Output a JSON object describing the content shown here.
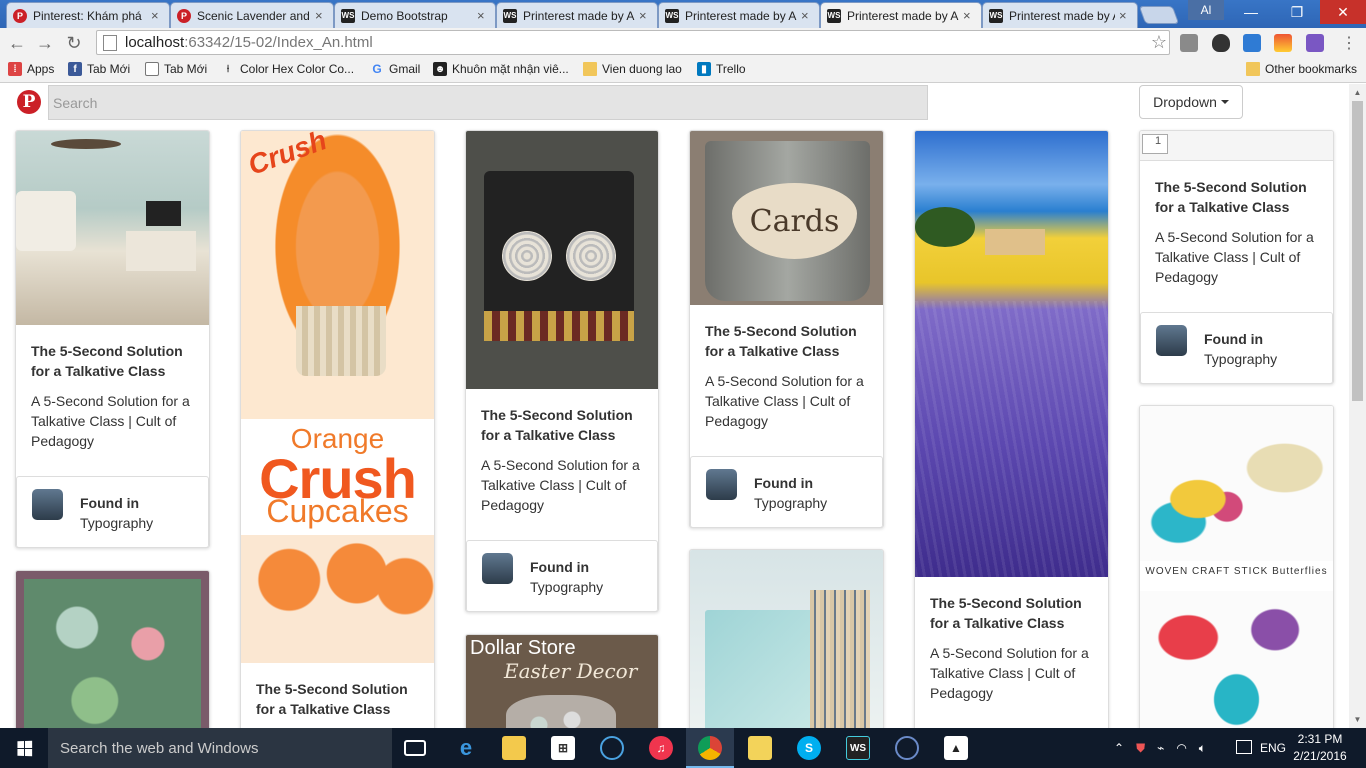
{
  "browser": {
    "tabs": [
      {
        "label": "Pinterest: Khám phá",
        "icon": "pinterest-icon",
        "active": false
      },
      {
        "label": "Scenic Lavender and",
        "icon": "pinterest-icon",
        "active": false
      },
      {
        "label": "Demo Bootstrap",
        "icon": "webstorm-icon",
        "active": false
      },
      {
        "label": "Printerest made by A",
        "icon": "webstorm-icon",
        "active": false
      },
      {
        "label": "Printerest made by A",
        "icon": "webstorm-icon",
        "active": false
      },
      {
        "label": "Printerest made by A",
        "icon": "webstorm-icon",
        "active": true
      },
      {
        "label": "Printerest made by A",
        "icon": "webstorm-icon",
        "active": false
      }
    ],
    "user_badge": "Al",
    "url_host": "localhost",
    "url_path": ":63342/15-02/Index_An.html",
    "bookmarks": [
      {
        "label": "Apps",
        "icon": "apps-grid-icon"
      },
      {
        "label": "Tab Mới",
        "icon": "facebook-icon"
      },
      {
        "label": "Tab Mới",
        "icon": "page-icon"
      },
      {
        "label": "Color Hex Color Co...",
        "icon": "pin-icon"
      },
      {
        "label": "Gmail",
        "icon": "google-icon"
      },
      {
        "label": "Khuôn mặt nhận viê...",
        "icon": "face-icon"
      },
      {
        "label": "Vien duong lao",
        "icon": "folder-icon"
      },
      {
        "label": "Trello",
        "icon": "trello-icon"
      }
    ],
    "other_bookmarks": "Other bookmarks"
  },
  "page": {
    "logo": "P",
    "search_placeholder": "Search",
    "dropdown_label": "Dropdown",
    "card_title": "The 5-Second Solution for a Talkative Class",
    "card_desc": "A 5-Second Solution for a Talkative Class | Cult of Pedagogy",
    "found_in": "Found in",
    "board": "Typography",
    "broken_alt": "1",
    "image_texts": {
      "crush": "Crush",
      "orange": "Orange",
      "crush_big": "Crush",
      "cupcakes": "Cupcakes",
      "cards": "Cards",
      "dollar_store": "Dollar Store",
      "easter_decor": "Easter Decor",
      "woven": "WOVEN CRAFT STICK Butterflies"
    }
  },
  "taskbar": {
    "search_placeholder": "Search the web and Windows",
    "language": "ENG",
    "time": "2:31 PM",
    "date": "2/21/2016"
  }
}
